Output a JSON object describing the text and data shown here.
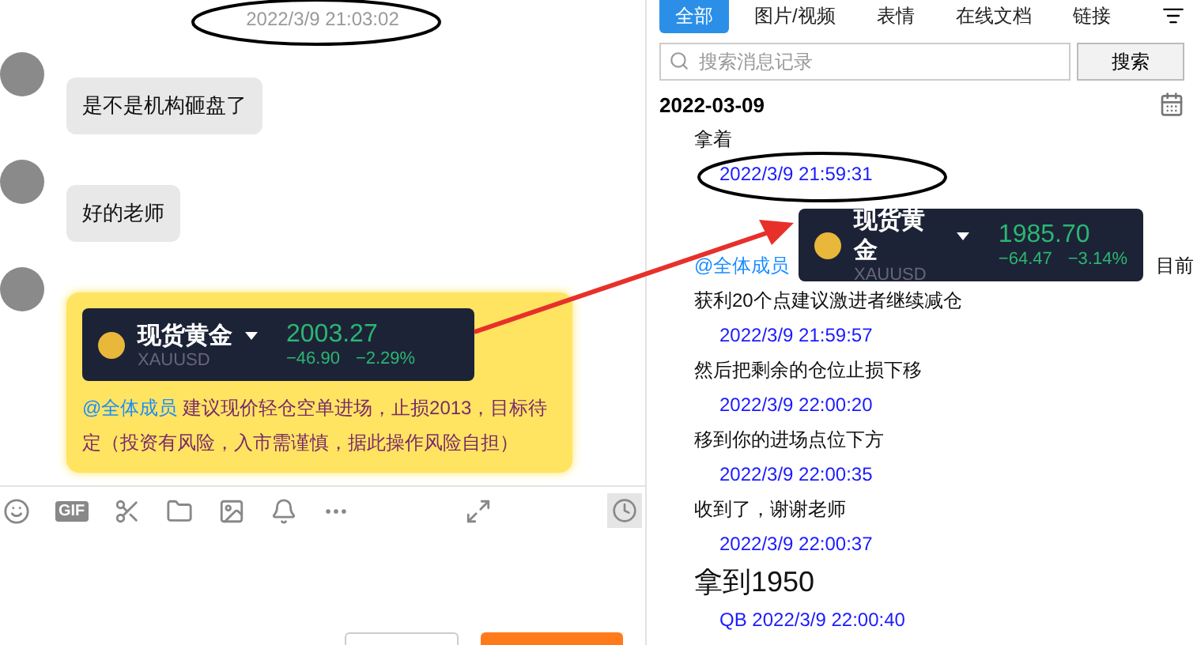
{
  "chat": {
    "timestamp": "2022/3/9 21:03:02",
    "toolbar": {
      "gif": "GIF"
    },
    "messages": [
      {
        "kind": "text",
        "text": "是不是机构砸盘了"
      },
      {
        "kind": "text",
        "text": "好的老师"
      },
      {
        "kind": "card",
        "quote": {
          "name": "现货黄金",
          "symbol": "XAUUSD",
          "price": "2003.27",
          "change": "−46.90",
          "percent": "−2.29%"
        },
        "mention": "@全体成员",
        "text": "建议现价轻仓空单进场，止损2013，目标待定（投资有风险，入市需谨慎，据此操作风险自担）"
      }
    ]
  },
  "history": {
    "tabs": [
      {
        "label": "全部",
        "selected": true
      },
      {
        "label": "图片/视频",
        "selected": false
      },
      {
        "label": "表情",
        "selected": false
      },
      {
        "label": "在线文档",
        "selected": false
      },
      {
        "label": "链接",
        "selected": false
      }
    ],
    "search": {
      "placeholder": "搜索消息记录",
      "button": "搜索"
    },
    "date": "2022-03-09",
    "entries": [
      {
        "kind": "text",
        "text": "拿着"
      },
      {
        "kind": "time",
        "text": "2022/3/9 21:59:31"
      },
      {
        "kind": "mention",
        "text": "@全体成员",
        "tail": "目前"
      },
      {
        "kind": "text",
        "text": "获利20个点建议激进者继续减仓"
      },
      {
        "kind": "time",
        "text": "2022/3/9 21:59:57"
      },
      {
        "kind": "text",
        "text": "然后把剩余的仓位止损下移"
      },
      {
        "kind": "time",
        "text": "2022/3/9 22:00:20"
      },
      {
        "kind": "text",
        "text": "移到你的进场点位下方"
      },
      {
        "kind": "time",
        "text": "2022/3/9 22:00:35"
      },
      {
        "kind": "text",
        "text": "收到了，谢谢老师"
      },
      {
        "kind": "time",
        "text": "2022/3/9 22:00:37"
      },
      {
        "kind": "big",
        "text": "拿到1950"
      },
      {
        "kind": "time",
        "text": "QB 2022/3/9 22:00:40"
      }
    ],
    "quote": {
      "name": "现货黄金",
      "symbol": "XAUUSD",
      "price": "1985.70",
      "change": "−64.47",
      "percent": "−3.14%"
    }
  }
}
